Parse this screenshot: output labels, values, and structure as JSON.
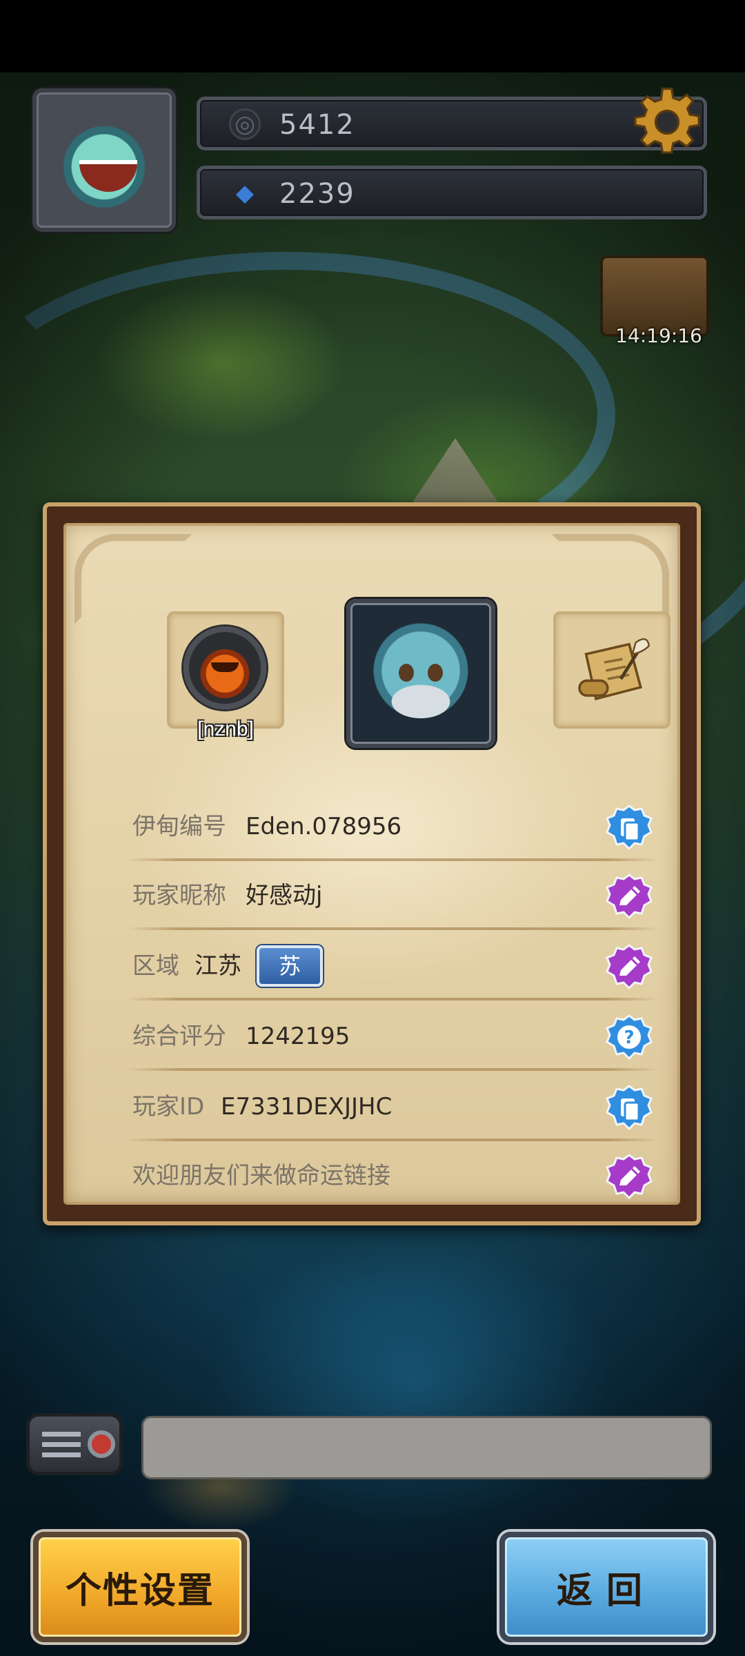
{
  "top_bar": {
    "coins": "5412",
    "gems": "2239",
    "event_timer": "14:19:16"
  },
  "profile": {
    "badge_name": "[nznb]",
    "rows": [
      {
        "label": "伊甸编号",
        "value": "Eden.078956",
        "action": "copy-icon"
      },
      {
        "label": "玩家昵称",
        "value": "好感动j",
        "action": "edit-icon"
      },
      {
        "label": "区域",
        "value": "江苏",
        "tag": "苏",
        "action": "edit-icon"
      },
      {
        "label": "综合评分",
        "value": "1242195",
        "action": "help-icon"
      },
      {
        "label": "玩家ID",
        "value": "E7331DEXJJHC",
        "action": "copy-icon"
      },
      {
        "label": "欢迎朋友们来做命运链接",
        "action": "edit-icon"
      }
    ]
  },
  "chat": {
    "input_value": ""
  },
  "buttons": {
    "personal_settings": "个性设置",
    "back": "返回"
  },
  "colors": {
    "copy_button": "#2f8ee0",
    "edit_button": "#a53bc8",
    "help_button": "#2f8ee0",
    "personal_button": "#f1a82a",
    "back_button": "#58a9df"
  }
}
